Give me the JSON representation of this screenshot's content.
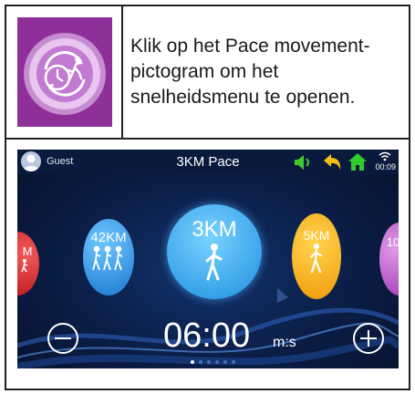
{
  "instruction": "Klik op het Pace movement-pictogram om het snelheidsmenu te openen.",
  "screen": {
    "user_label": "Guest",
    "title": "3KM Pace",
    "clock": "00:09",
    "presets": {
      "left_partial": "M",
      "preset_42": "42KM",
      "preset_3": "3KM",
      "preset_5": "5KM",
      "right_partial": "10"
    },
    "pace_value": "06:00",
    "pace_unit": "m:s",
    "page_count": 6,
    "current_page": 1
  },
  "colors": {
    "icon_bg": "#8e2f9a",
    "screen_bg": "#0b1d45",
    "speaker_icon": "#3ecb2f",
    "back_icon": "#f2c018",
    "home_icon": "#2fcb2f",
    "preset_red": "#d2262d",
    "preset_blue": "#1d8fe0",
    "preset_yellow": "#f5a912",
    "preset_purple": "#b94ccf"
  }
}
